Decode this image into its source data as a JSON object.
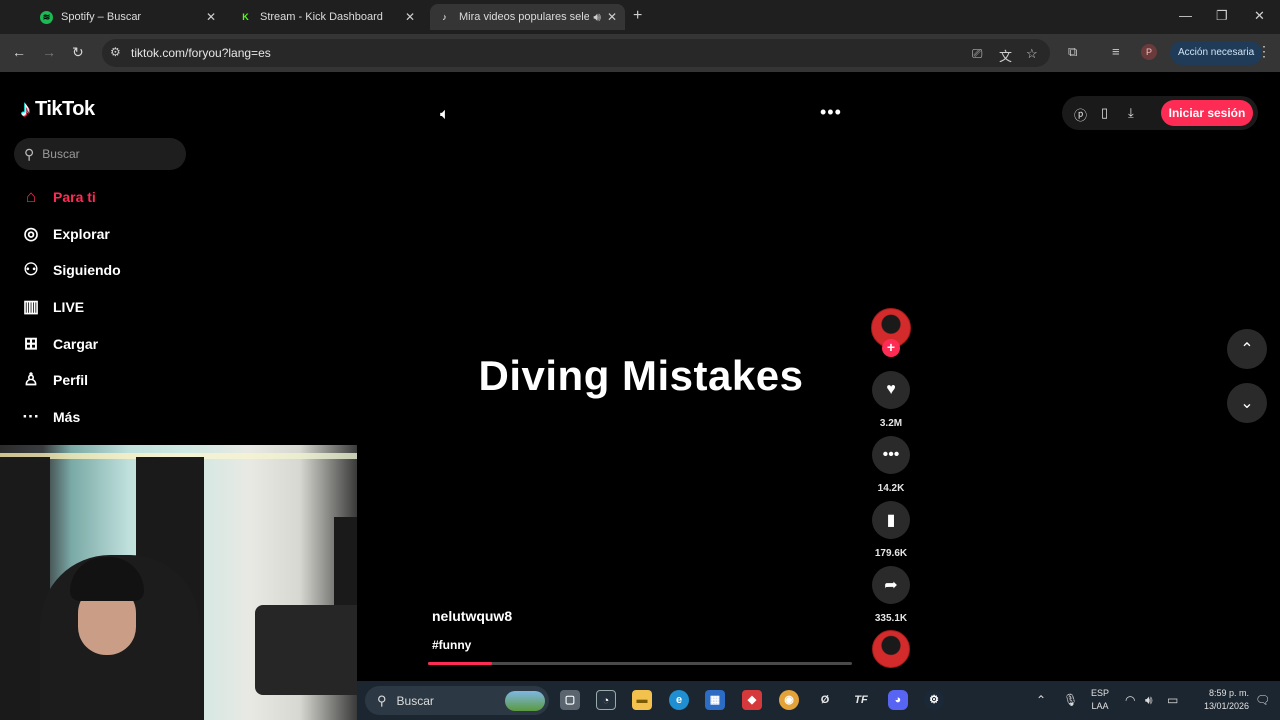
{
  "browser": {
    "tabs": [
      {
        "title": "Spotify – Buscar",
        "favicon_color": "#1db954"
      },
      {
        "title": "Stream - Kick Dashboard",
        "favicon_color": "#53fc18"
      },
      {
        "title": "Mira videos populares selec",
        "favicon_color": "#ffffff"
      }
    ],
    "url": "tiktok.com/foryou?lang=es",
    "profile_initial": "P",
    "action_label": "Acción necesaria"
  },
  "tiktok": {
    "logo": "TikTok",
    "search_placeholder": "Buscar",
    "nav": [
      {
        "label": "Para ti",
        "icon": "home-icon"
      },
      {
        "label": "Explorar",
        "icon": "compass-icon"
      },
      {
        "label": "Siguiendo",
        "icon": "following-icon"
      },
      {
        "label": "LIVE",
        "icon": "live-icon"
      },
      {
        "label": "Cargar",
        "icon": "upload-icon"
      },
      {
        "label": "Perfil",
        "icon": "profile-icon"
      },
      {
        "label": "Más",
        "icon": "more-icon"
      }
    ],
    "login_label": "Iniciar sesión",
    "accent": "#fe2c55"
  },
  "video": {
    "title": "Diving Mistakes",
    "author": "nelutwquw8",
    "hashtag": "#funny",
    "progress": 0.15,
    "likes": "3.2M",
    "comments": "14.2K",
    "saves": "179.6K",
    "shares": "335.1K"
  },
  "taskbar": {
    "search_label": "Buscar",
    "lang_line1": "ESP",
    "lang_line2": "LAA",
    "time": "8:59 p. m.",
    "date": "13/01/2026"
  }
}
